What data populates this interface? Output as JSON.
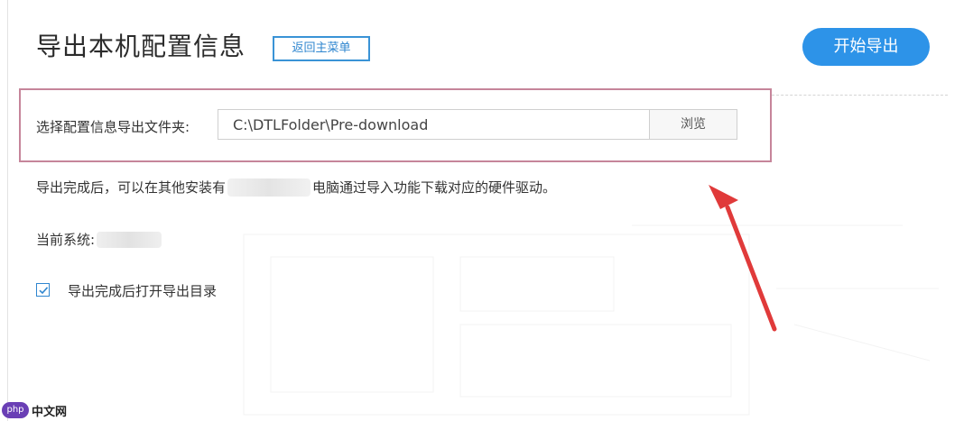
{
  "header": {
    "title": "导出本机配置信息",
    "back_link": "返回主菜单",
    "start_button": "开始导出"
  },
  "folder": {
    "label": "选择配置信息导出文件夹:",
    "path_value": "C:\\DTLFolder\\Pre-download",
    "browse_button": "浏览"
  },
  "info": {
    "text_before": "导出完成后，可以在其他安装有",
    "text_after": "电脑通过导入功能下载对应的硬件驱动。"
  },
  "system": {
    "label": "当前系统:"
  },
  "options": {
    "open_dir_checked": true,
    "open_dir_label": "导出完成后打开导出目录"
  },
  "watermark": {
    "badge": "php",
    "text": "中文网"
  },
  "colors": {
    "accent": "#2d93e8",
    "link": "#2f86cf",
    "highlight_border": "#c6859a",
    "annotation_arrow": "#e03a3a"
  }
}
